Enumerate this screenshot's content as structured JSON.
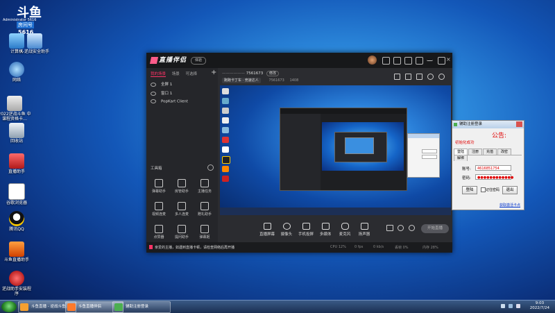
{
  "desktop": {
    "icons": [
      {
        "label": "计算机"
      },
      {
        "label": "X-逆战安全助手"
      },
      {
        "label": "网络"
      },
      {
        "label": "2022逆战斗鱼 中课程资格卡…"
      },
      {
        "label": "回收站"
      },
      {
        "label": "直播助手"
      },
      {
        "label": "谷歌浏览器"
      },
      {
        "label": "腾讯QQ"
      },
      {
        "label": "斗鱼直播助手"
      },
      {
        "label": "逆战助手安装程序"
      }
    ],
    "overlay_text": "Administrator 5616",
    "overlay_brand": "斗鱼",
    "overlay_sub": "房间号",
    "overlay_num": "5616"
  },
  "app": {
    "logo": "直播伴侣",
    "tag": "体验",
    "sidebar": {
      "tabs": [
        {
          "label": "我的场景",
          "active": true
        },
        {
          "label": "场景"
        },
        {
          "label": "可选择"
        }
      ],
      "sources": [
        "全屏 1",
        "窗口 1",
        "PopKart Client"
      ],
      "tools_title": "工具箱",
      "tools": [
        "弹幕助手",
        "房管助手",
        "主播任务",
        "视频连麦",
        "多人连麦",
        "赠礼助手",
        "点赞器",
        "提问助手",
        "弹幕姬"
      ]
    },
    "room": {
      "title": "7561673",
      "edit": "修改",
      "category": "跑跑卡丁车 · 竞速达人",
      "room_id": "7561673",
      "fans": "1408"
    },
    "controls": [
      "直播屏幕",
      "摄像头",
      "手机投屏",
      "多媒体",
      "麦克风",
      "扬声器"
    ],
    "go_live": "开始直播",
    "notice": "亲爱的主播，如遇到直播卡顿，请检查网络后再开播",
    "stats": [
      "CPU 12%",
      "0 fps",
      "0 kb/s",
      "丢帧 0%",
      "内存 28%"
    ]
  },
  "login_dialog": {
    "title": "辅助注册登录",
    "notice_label": "公告:",
    "success": "初始化成功",
    "tabs": [
      "登陆",
      "注册",
      "充值",
      "改密",
      "解绑"
    ],
    "account_label": "账号:",
    "account_value": "4616851754",
    "password_label": "密码:",
    "password_value": "●●●●●●●●●●●●",
    "login_button": "登陆",
    "remember": "记住密码",
    "exit_button": "退出",
    "register_link": "获取激活卡点"
  },
  "taskbar": {
    "items": [
      {
        "label": "斗鱼直播 - 逆战斗鱼…"
      },
      {
        "label": "斗鱼直播伴侣"
      },
      {
        "label": "辅助注册登录"
      }
    ],
    "time": "9:03",
    "date": "2022/7/24"
  }
}
